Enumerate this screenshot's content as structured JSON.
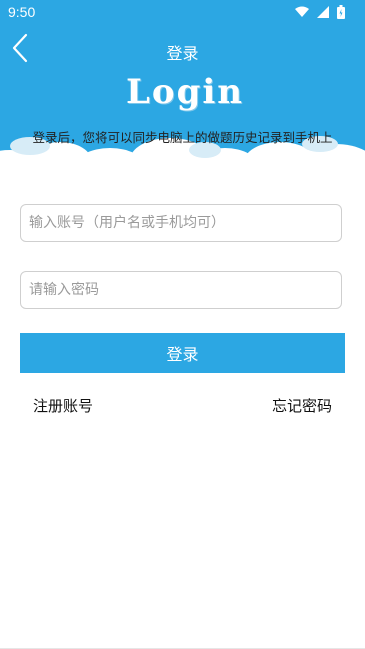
{
  "status": {
    "time": "9:50"
  },
  "header": {
    "title": "登录",
    "logo_text": "Login",
    "subtitle": "登录后，您将可以同步电脑上的做题历史记录到手机上"
  },
  "form": {
    "account_placeholder": "输入账号（用户名或手机均可）",
    "account_value": "",
    "password_placeholder": "请输入密码",
    "password_value": "",
    "login_label": "登录"
  },
  "links": {
    "register": "注册账号",
    "forgot": "忘记密码"
  },
  "colors": {
    "accent": "#2ca7e3"
  }
}
